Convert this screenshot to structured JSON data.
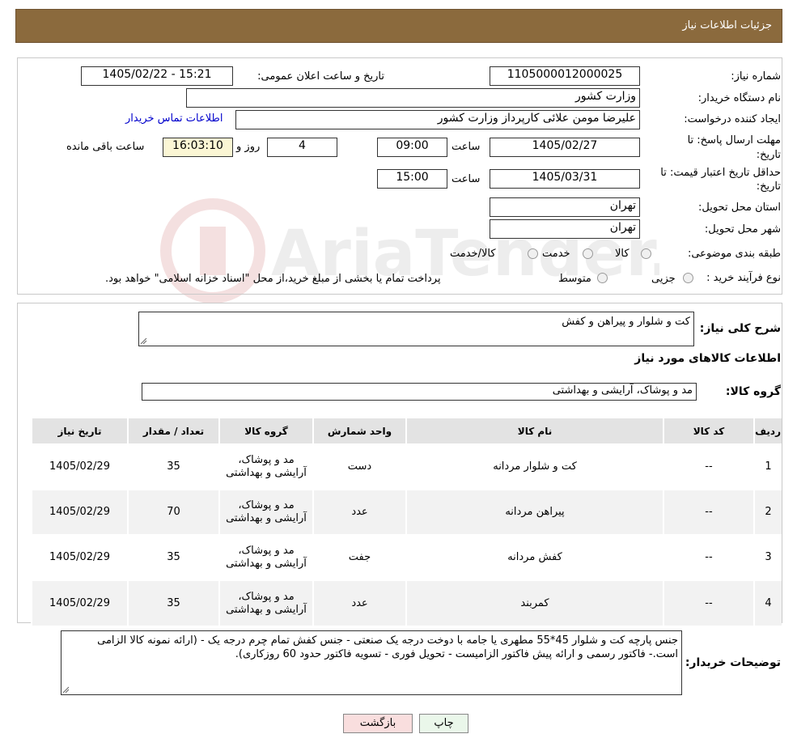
{
  "header": {
    "title": "جزئیات اطلاعات نیاز"
  },
  "watermark": {
    "text": "AriaTender.neT"
  },
  "info": {
    "need_number_label": "شماره نیاز:",
    "need_number": "1105000012000025",
    "announce_label": "تاریخ و ساعت اعلان عمومی:",
    "announce_value": "1405/02/22 - 15:21",
    "buyer_org_label": "نام دستگاه خریدار:",
    "buyer_org": "وزارت کشور",
    "creator_label": "ایجاد کننده درخواست:",
    "creator": "علیرضا مومن علائی کارپرداز وزارت کشور",
    "contact_link": "اطلاعات تماس خریدار",
    "deadline_label_1": "مهلت ارسال پاسخ: تا",
    "deadline_label_2": "تاریخ:",
    "deadline_date": "1405/02/27",
    "time_label": "ساعت",
    "deadline_time": "09:00",
    "days_value": "4",
    "days_label": "روز و",
    "remaining_time": "16:03:10",
    "remaining_label": "ساعت باقی مانده",
    "validity_label_1": "حداقل تاریخ اعتبار قیمت: تا",
    "validity_label_2": "تاریخ:",
    "validity_date": "1405/03/31",
    "validity_time_label": "ساعت",
    "validity_time": "15:00",
    "province_label": "استان محل تحویل:",
    "province": "تهران",
    "city_label": "شهر محل تحویل:",
    "city": "تهران",
    "category_label": "طبقه بندی موضوعی:",
    "category_options": [
      "کالا",
      "خدمت",
      "کالا/خدمت"
    ],
    "process_label": "نوع فرآیند خرید :",
    "process_options": [
      "جزیی",
      "متوسط"
    ],
    "process_note": "پرداخت تمام یا بخشی از مبلغ خرید،از محل \"اسناد خزانه اسلامی\" خواهد بود."
  },
  "summary": {
    "label": "شرح کلی نیاز:",
    "value": "کت و شلوار و پیراهن و کفش",
    "goods_info_title": "اطلاعات کالاهای مورد نیاز",
    "group_label": "گروه کالا:",
    "group_value": "مد و پوشاک، آرایشی و بهداشتی"
  },
  "table": {
    "headers": [
      "ردیف",
      "کد کالا",
      "نام کالا",
      "واحد شمارش",
      "گروه کالا",
      "تعداد / مقدار",
      "تاریخ نیاز"
    ],
    "rows": [
      {
        "row": "1",
        "code": "--",
        "name": "کت و شلوار مردانه",
        "unit": "دست",
        "group": "مد و پوشاک، آرایشی و بهداشتی",
        "qty": "35",
        "date": "1405/02/29"
      },
      {
        "row": "2",
        "code": "--",
        "name": "پیراهن مردانه",
        "unit": "عدد",
        "group": "مد و پوشاک، آرایشی و بهداشتی",
        "qty": "70",
        "date": "1405/02/29"
      },
      {
        "row": "3",
        "code": "--",
        "name": "کفش مردانه",
        "unit": "جفت",
        "group": "مد و پوشاک، آرایشی و بهداشتی",
        "qty": "35",
        "date": "1405/02/29"
      },
      {
        "row": "4",
        "code": "--",
        "name": "کمربند",
        "unit": "عدد",
        "group": "مد و پوشاک، آرایشی و بهداشتی",
        "qty": "35",
        "date": "1405/02/29"
      }
    ]
  },
  "notes": {
    "label": "توضیحات خریدار:",
    "value": "جنس پارچه کت و شلوار 45*55 مطهری یا جامه با دوخت درجه یک صنعتی - جنس کفش تمام چرم درجه یک - (ارائه نمونه کالا الزامی است.- فاکتور رسمی و ارائه پیش فاکتور الزامیست -  تحویل فوری - تسویه فاکتور حدود 60 روزکاری)."
  },
  "buttons": {
    "print": "چاپ",
    "back": "بازگشت"
  },
  "colors": {
    "header": "#8b6a3d",
    "link": "#0000cc",
    "back_button": "#f9dede",
    "print_button": "#eaf7ea"
  }
}
